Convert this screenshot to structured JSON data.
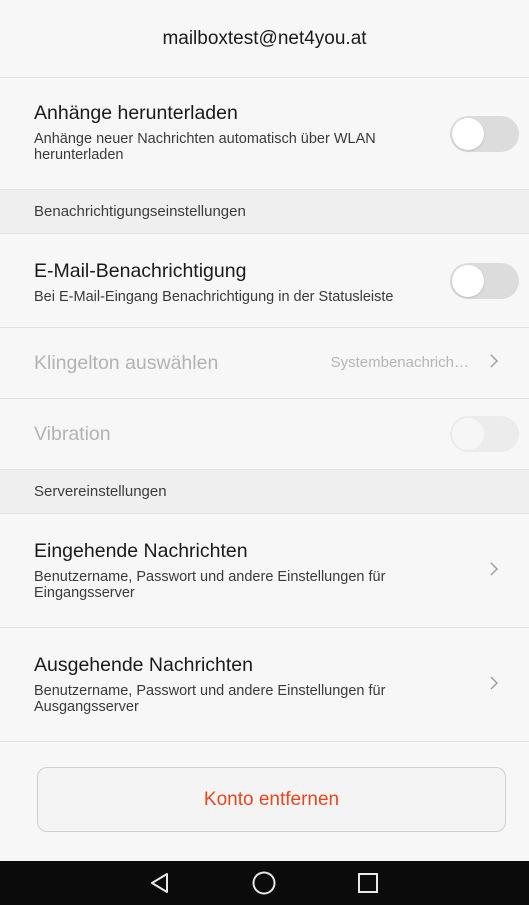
{
  "header": {
    "title": "mailboxtest@net4you.at"
  },
  "attachments": {
    "title": "Anhänge herunterladen",
    "subtitle": "Anhänge neuer Nachrichten automatisch über WLAN herunterladen",
    "toggle_on": false
  },
  "section_notifications": "Benachrichtigungseinstellungen",
  "email_notification": {
    "title": "E-Mail-Benachrichtigung",
    "subtitle": "Bei E-Mail-Eingang Benachrichtigung in der Statusleiste",
    "toggle_on": false
  },
  "ringtone": {
    "title": "Klingelton auswählen",
    "value": "Systembenachrich…"
  },
  "vibration": {
    "title": "Vibration",
    "toggle_on": false
  },
  "section_server": "Servereinstellungen",
  "incoming": {
    "title": "Eingehende Nachrichten",
    "subtitle": "Benutzername, Passwort und andere Einstellungen für Eingangsserver"
  },
  "outgoing": {
    "title": "Ausgehende Nachrichten",
    "subtitle": "Benutzername, Passwort und andere Einstellungen für Ausgangsserver"
  },
  "remove_account": {
    "label": "Konto entfernen"
  },
  "navbar": {
    "back_icon": "back-triangle-icon",
    "home_icon": "home-circle-icon",
    "recents_icon": "recents-square-icon"
  },
  "colors": {
    "danger": "#e8471f",
    "background": "#f7f7f7",
    "section": "#efefef"
  }
}
